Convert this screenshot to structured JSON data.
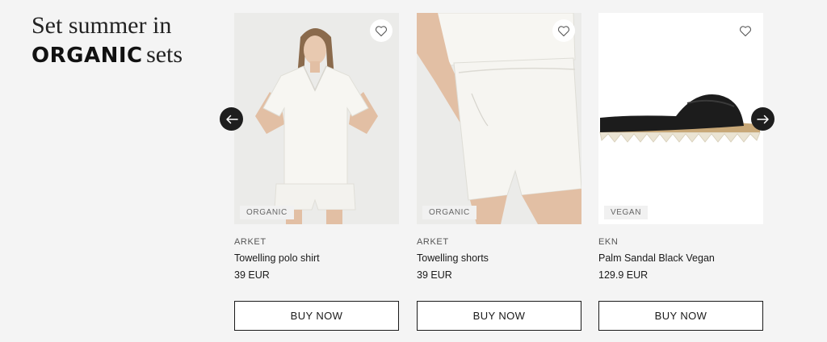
{
  "headline": {
    "line1": "Set summer in",
    "emphasis": "ORGANIC",
    "suffix": "sets"
  },
  "carousel": {
    "prev_icon": "arrow-left-icon",
    "next_icon": "arrow-right-icon"
  },
  "products": [
    {
      "tag": "ORGANIC",
      "brand": "ARKET",
      "name": "Towelling polo shirt",
      "price": "39 EUR",
      "cta": "BUY NOW"
    },
    {
      "tag": "ORGANIC",
      "brand": "ARKET",
      "name": "Towelling shorts",
      "price": "39 EUR",
      "cta": "BUY NOW"
    },
    {
      "tag": "VEGAN",
      "brand": "EKN",
      "name": "Palm Sandal Black Vegan",
      "price": "129.9 EUR",
      "cta": "BUY NOW"
    }
  ],
  "colors": {
    "background": "#f4f4f4",
    "text": "#1a1a1a",
    "arrow": "#1e1e1e"
  }
}
